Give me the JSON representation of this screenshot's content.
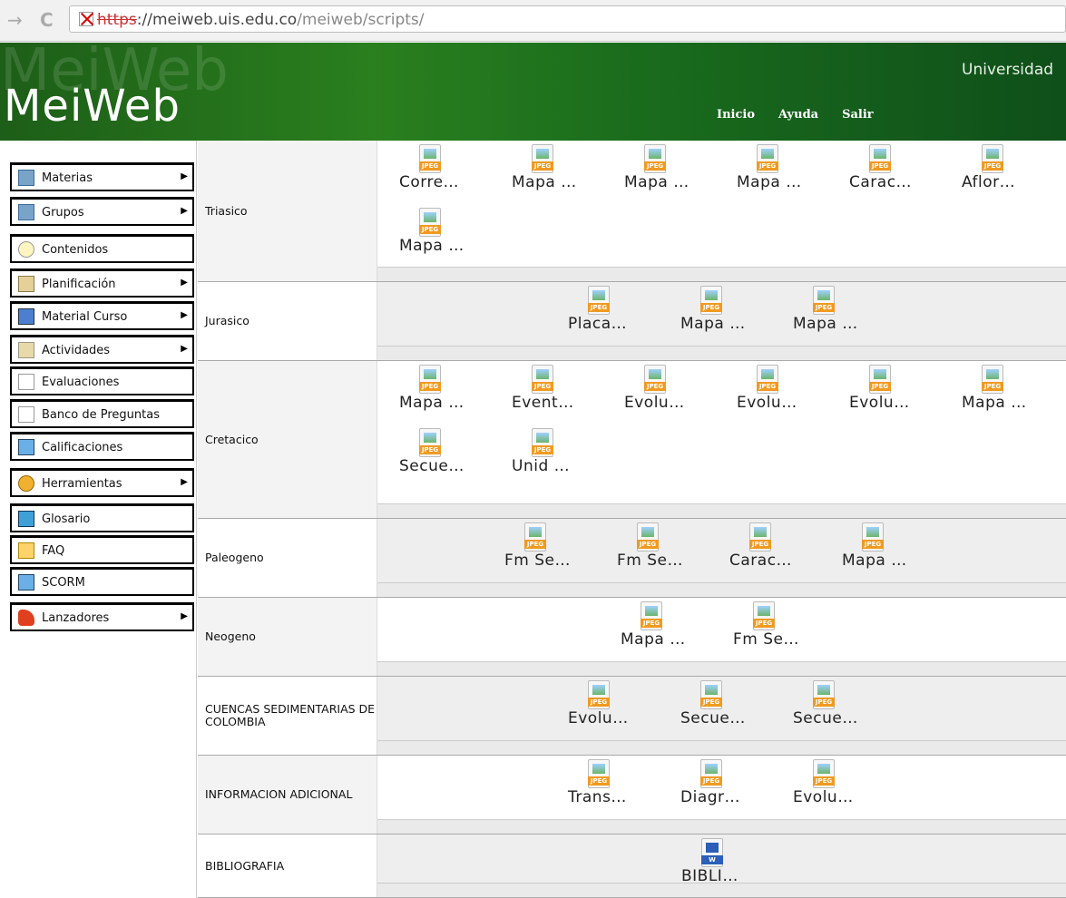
{
  "browser": {
    "url_scheme": "https",
    "url_host_sep": "://",
    "url_host": "meiweb.uis.edu.co",
    "url_path": "/meiweb/scripts/"
  },
  "header": {
    "logo_ghost": "MeiWeb",
    "logo": "MeiWeb",
    "university": "Universidad",
    "menu": [
      "Inicio",
      "Ayuda",
      "Salir"
    ]
  },
  "sidebar": {
    "items": [
      {
        "label": "Materias",
        "icon": "folder-icon",
        "submenu": true
      },
      {
        "label": "Grupos",
        "icon": "folder-icon",
        "submenu": true
      },
      {
        "label": "Contenidos",
        "icon": "lightbulb-icon",
        "submenu": false
      },
      {
        "label": "Planificación",
        "icon": "pencil-icon",
        "submenu": true
      },
      {
        "label": "Material Curso",
        "icon": "book-icon",
        "submenu": true
      },
      {
        "label": "Actividades",
        "icon": "scroll-icon",
        "submenu": true
      },
      {
        "label": "Evaluaciones",
        "icon": "page-icon",
        "submenu": false
      },
      {
        "label": "Banco de Preguntas",
        "icon": "page-icon",
        "submenu": false
      },
      {
        "label": "Calificaciones",
        "icon": "grid-icon",
        "submenu": false
      },
      {
        "label": "Herramientas",
        "icon": "gear-icon",
        "submenu": true
      },
      {
        "label": "Glosario",
        "icon": "glossary-icon",
        "submenu": false
      },
      {
        "label": "FAQ",
        "icon": "faq-icon",
        "submenu": false
      },
      {
        "label": "SCORM",
        "icon": "grid-icon",
        "submenu": false
      },
      {
        "label": "Lanzadores",
        "icon": "rocket-icon",
        "submenu": true
      }
    ]
  },
  "sections": [
    {
      "name": "Triasico",
      "files": [
        "Corre…",
        "Mapa …",
        "Mapa …",
        "Mapa …",
        "Carac…",
        "Aflor…",
        "Mapa …"
      ]
    },
    {
      "name": "Jurasico",
      "files": [
        "Placa…",
        "Mapa …",
        "Mapa …"
      ]
    },
    {
      "name": "Cretacico",
      "files": [
        "Mapa …",
        "Event…",
        "Evolu…",
        "Evolu…",
        "Evolu…",
        "Mapa …",
        "Secue…",
        "Unid …"
      ]
    },
    {
      "name": "Paleogeno",
      "files": [
        "Fm Se…",
        "Fm Se…",
        "Carac…",
        "Mapa …"
      ]
    },
    {
      "name": "Neogeno",
      "files": [
        "Mapa …",
        "Fm Se…"
      ]
    },
    {
      "name": "CUENCAS SEDIMENTARIAS DE COLOMBIA",
      "files": [
        "Evolu…",
        "Secue…",
        "Secue…"
      ]
    },
    {
      "name": "INFORMACION ADICIONAL",
      "files": [
        "Trans…",
        "Diagr…",
        "Evolu…"
      ]
    },
    {
      "name": "BIBLIOGRAFIA",
      "files": [
        "BIBLI…"
      ]
    }
  ]
}
